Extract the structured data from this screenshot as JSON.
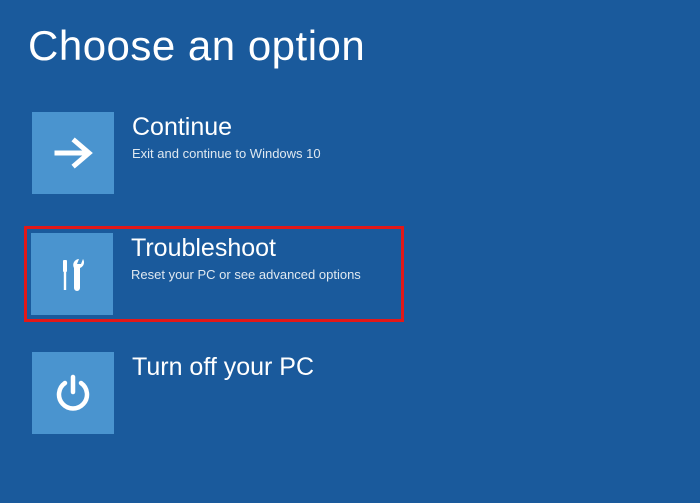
{
  "page_title": "Choose an option",
  "options": {
    "continue": {
      "title": "Continue",
      "desc": "Exit and continue to Windows 10"
    },
    "troubleshoot": {
      "title": "Troubleshoot",
      "desc": "Reset your PC or see advanced options"
    },
    "poweroff": {
      "title": "Turn off your PC",
      "desc": ""
    }
  },
  "colors": {
    "bg": "#1a5a9c",
    "tile": "#4a94cf",
    "highlight": "#e31818"
  }
}
